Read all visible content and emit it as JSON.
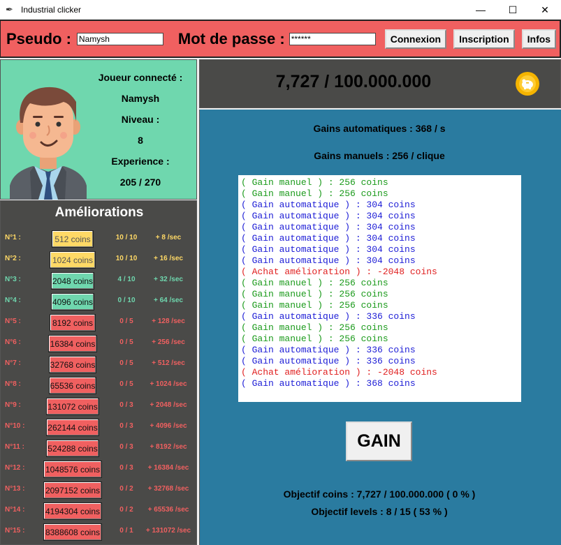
{
  "window": {
    "title": "Industrial clicker",
    "minimize": "—",
    "maximize": "☐",
    "close": "✕"
  },
  "login": {
    "pseudo_label": "Pseudo :",
    "pseudo_value": "Namysh",
    "password_label": "Mot de passe :",
    "password_value": "******",
    "connexion_label": "Connexion",
    "inscription_label": "Inscription",
    "infos_label": "Infos"
  },
  "player": {
    "connected_label": "Joueur connecté :",
    "name": "Namysh",
    "level_label": "Niveau :",
    "level": "8",
    "experience_label": "Experience :",
    "experience": "205 / 270"
  },
  "upgrades": {
    "title": "Améliorations",
    "items": [
      {
        "num": "N°1 :",
        "cost": "512 coins",
        "level": "10 / 10",
        "gain": "+ 8 /sec",
        "color": "yellow"
      },
      {
        "num": "N°2 :",
        "cost": "1024 coins",
        "level": "10 / 10",
        "gain": "+ 16 /sec",
        "color": "yellow"
      },
      {
        "num": "N°3 :",
        "cost": "2048 coins",
        "level": "4 / 10",
        "gain": "+ 32 /sec",
        "color": "green"
      },
      {
        "num": "N°4 :",
        "cost": "4096 coins",
        "level": "0 / 10",
        "gain": "+ 64 /sec",
        "color": "green"
      },
      {
        "num": "N°5 :",
        "cost": "8192 coins",
        "level": "0 / 5",
        "gain": "+ 128 /sec",
        "color": "red"
      },
      {
        "num": "N°6 :",
        "cost": "16384 coins",
        "level": "0 / 5",
        "gain": "+ 256 /sec",
        "color": "red"
      },
      {
        "num": "N°7 :",
        "cost": "32768 coins",
        "level": "0 / 5",
        "gain": "+ 512 /sec",
        "color": "red"
      },
      {
        "num": "N°8 :",
        "cost": "65536 coins",
        "level": "0 / 5",
        "gain": "+ 1024 /sec",
        "color": "red"
      },
      {
        "num": "N°9 :",
        "cost": "131072 coins",
        "level": "0 / 3",
        "gain": "+ 2048 /sec",
        "color": "red"
      },
      {
        "num": "N°10 :",
        "cost": "262144 coins",
        "level": "0 / 3",
        "gain": "+ 4096 /sec",
        "color": "red"
      },
      {
        "num": "N°11 :",
        "cost": "524288 coins",
        "level": "0 / 3",
        "gain": "+ 8192 /sec",
        "color": "red"
      },
      {
        "num": "N°12 :",
        "cost": "1048576 coins",
        "level": "0 / 3",
        "gain": "+ 16384 /sec",
        "color": "red"
      },
      {
        "num": "N°13 :",
        "cost": "2097152 coins",
        "level": "0 / 2",
        "gain": "+ 32768 /sec",
        "color": "red"
      },
      {
        "num": "N°14 :",
        "cost": "4194304 coins",
        "level": "0 / 2",
        "gain": "+ 65536 /sec",
        "color": "red"
      },
      {
        "num": "N°15 :",
        "cost": "8388608 coins",
        "level": "0 / 1",
        "gain": "+ 131072 /sec",
        "color": "red"
      }
    ]
  },
  "coins": {
    "display": "7,727 / 100.000.000",
    "icon": "piggy-bank-coin-icon"
  },
  "stats": {
    "auto_gains": "Gains automatiques : 368 / s",
    "manual_gains": "Gains manuels  : 256 / clique"
  },
  "log": [
    {
      "type": "manuel",
      "text": "( Gain manuel ) : 256 coins"
    },
    {
      "type": "manuel",
      "text": "( Gain manuel ) : 256 coins"
    },
    {
      "type": "auto",
      "text": "( Gain automatique ) : 304 coins"
    },
    {
      "type": "auto",
      "text": "( Gain automatique ) : 304 coins"
    },
    {
      "type": "auto",
      "text": "( Gain automatique ) : 304 coins"
    },
    {
      "type": "auto",
      "text": "( Gain automatique ) : 304 coins"
    },
    {
      "type": "auto",
      "text": "( Gain automatique ) : 304 coins"
    },
    {
      "type": "auto",
      "text": "( Gain automatique ) : 304 coins"
    },
    {
      "type": "achat",
      "text": "( Achat amélioration ) : -2048 coins"
    },
    {
      "type": "manuel",
      "text": "( Gain manuel ) : 256 coins"
    },
    {
      "type": "manuel",
      "text": "( Gain manuel ) : 256 coins"
    },
    {
      "type": "manuel",
      "text": "( Gain manuel ) : 256 coins"
    },
    {
      "type": "auto",
      "text": "( Gain automatique ) : 336 coins"
    },
    {
      "type": "manuel",
      "text": "( Gain manuel ) : 256 coins"
    },
    {
      "type": "manuel",
      "text": "( Gain manuel ) : 256 coins"
    },
    {
      "type": "auto",
      "text": "( Gain automatique ) : 336 coins"
    },
    {
      "type": "auto",
      "text": "( Gain automatique ) : 336 coins"
    },
    {
      "type": "achat",
      "text": "( Achat amélioration ) : -2048 coins"
    },
    {
      "type": "auto",
      "text": "( Gain automatique ) : 368 coins"
    }
  ],
  "gain_button_label": "GAIN",
  "objectives": {
    "coins": "Objectif coins : 7,727  /  100.000.000 ( 0 % )",
    "levels": "Objectif levels : 8  /  15 ( 53 % )"
  }
}
